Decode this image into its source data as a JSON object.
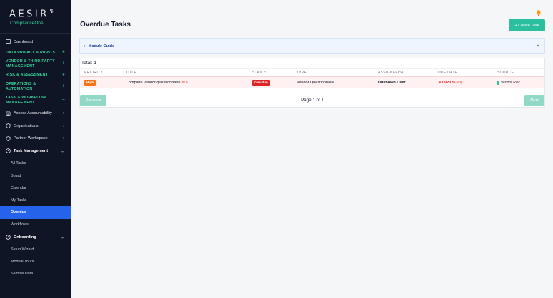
{
  "brand": {
    "name": "AESIR",
    "mark": "↯",
    "product": "ComplianceOne"
  },
  "sidebar": {
    "dashboard": "Dashboard",
    "sections": [
      {
        "label": "DATA PRIVACY & RIGHTS",
        "toggle": "+"
      },
      {
        "label": "VENDOR & THIRD-PARTY MANAGEMENT",
        "toggle": "+"
      },
      {
        "label": "RISK & ASSESSMENT",
        "toggle": "+"
      },
      {
        "label": "OPERATIONS & AUTOMATION",
        "toggle": "+"
      },
      {
        "label": "TASK & WORKFLOW MANAGEMENT",
        "toggle": "−"
      }
    ],
    "items": {
      "access_accountability": "Access Accountability",
      "organizations": "Organizations",
      "partner_workspace": "Partner Workspace",
      "task_management": "Task Management",
      "onboarding": "Onboarding"
    },
    "task_sub": [
      "All Tasks",
      "Board",
      "Calendar",
      "My Tasks",
      "Overdue",
      "Workflows"
    ],
    "onboarding_sub": [
      "Setup Wizard",
      "Module Tours",
      "Sample Data"
    ]
  },
  "header": {
    "title": "Overdue Tasks",
    "create_label": "+ Create Task"
  },
  "guide": {
    "caret": "›",
    "label": "Module Guide",
    "close": "×"
  },
  "table": {
    "total": "Total: 1",
    "columns": [
      "PRIORITY",
      "TITLE",
      "STATUS",
      "TYPE",
      "ASSIGNEE(S)",
      "DUE DATE",
      "SOURCE"
    ],
    "rows": [
      {
        "priority": "High",
        "title": "Complete vendor questionnaire",
        "sla": "SLA",
        "status": "Overdue",
        "type": "Vendor Questionnaire",
        "assignee": "Unknown User",
        "due": "3/18/2026",
        "due_note": "(od)",
        "source": "Vendor Risk"
      }
    ]
  },
  "pagination": {
    "prev": "Previous",
    "info": "Page 1 of 1",
    "next": "Next"
  },
  "colors": {
    "sidebar_bg": "#0f1524",
    "accent": "#2bbf9e",
    "active": "#2563eb",
    "danger": "#dc2626",
    "high": "#f97316"
  }
}
